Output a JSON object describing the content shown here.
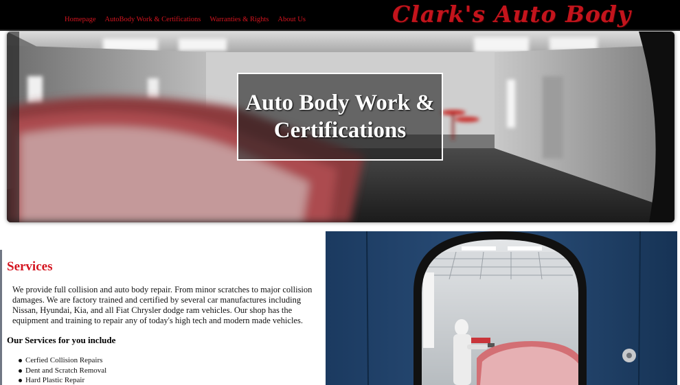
{
  "nav": {
    "links": [
      "Homepage",
      "AutoBody Work & Certifications",
      "Warranties & Rights",
      "About Us"
    ],
    "brand": "Clark's Auto Body",
    "link_color": "#d4141f"
  },
  "hero": {
    "title_line1": "Auto Body Work &",
    "title_line2": "Certifications"
  },
  "services": {
    "heading": "Services",
    "description": "We provide full collision and auto body repair. From minor scratches to major collision damages. We are factory trained and certified by several car manufactures including Nissan, Hyundai, Kia, and all Fiat Chrysler dodge ram vehicles. Our shop has the equipment and training to repair any of today's high tech and modern made vehicles.",
    "subheading": "Our Services for you include",
    "items": [
      "Cerfied Collision Repairs",
      "Dent and Scratch Removal",
      "Hard Plastic Repair"
    ]
  },
  "colors": {
    "accent": "#d4141f",
    "nav_bg": "#000000",
    "booth_blue": "#16375e"
  },
  "icons": {
    "side_photo_subject": "painter-in-spray-booth"
  }
}
